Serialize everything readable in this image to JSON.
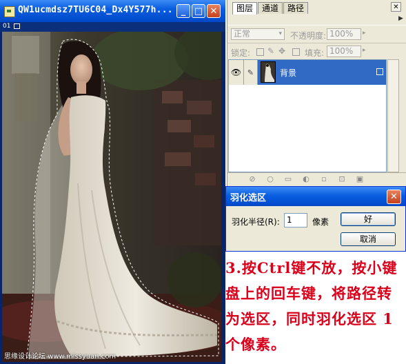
{
  "document": {
    "title": "QW1ucmdsz7TU6C04_Dx4Y577h...",
    "min_glyph": "_",
    "max_glyph": "□",
    "close_glyph": "✕",
    "strip_left": "01",
    "watermark": "思缘设计论坛  www.missyuan.com"
  },
  "layers_panel": {
    "tabs": [
      "图层",
      "通道",
      "路径"
    ],
    "close_glyph": "✕",
    "menu_glyph": "▶",
    "blend_mode": "正常",
    "opacity_label": "不透明度:",
    "opacity_value": "100%",
    "lock_label": "锁定:",
    "fill_label": "填充:",
    "fill_value": "100%",
    "layer": {
      "name": "背景",
      "visible_glyph": "👁",
      "brush_glyph": "✎"
    }
  },
  "dialog": {
    "title": "羽化选区",
    "close_glyph": "✕",
    "radius_label": "羽化半径(R):",
    "radius_value": "1",
    "unit": "像素",
    "ok_label": "好",
    "cancel_label": "取消"
  },
  "note": {
    "text": "3.按Ctrl键不放，按小键盘上的回车键，将路径转为选区，同时羽化选区 1 个像素。"
  },
  "colors": {
    "xp_title_blue": "#0a5ee0",
    "panel_bg": "#ece9d8",
    "layer_selected": "#316ac5",
    "note_red": "#d9001b"
  }
}
